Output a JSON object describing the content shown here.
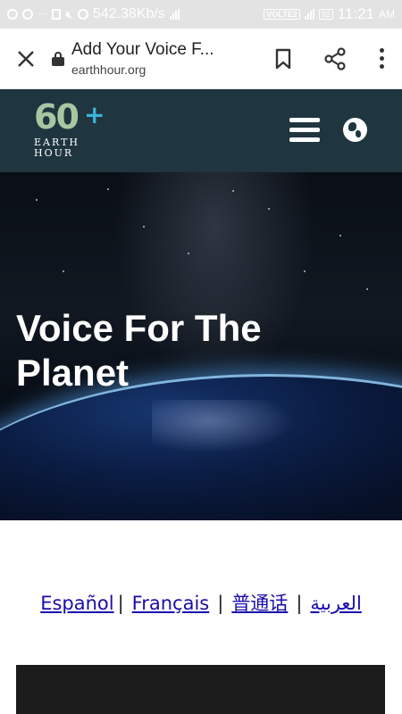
{
  "status_bar": {
    "network_speed": "542.38Kb/s",
    "volte": "VOLTE2",
    "battery": "92",
    "time": "11:21",
    "ampm": "AM"
  },
  "browser": {
    "close_icon": "close-icon",
    "page_title": "Add Your Voice F...",
    "url": "earthhour.org",
    "bookmark_icon": "bookmark-icon",
    "share_icon": "share-icon",
    "menu_icon": "more-vert-icon"
  },
  "site": {
    "logo_number": "60",
    "logo_plus": "+",
    "logo_line1": "EARTH",
    "logo_line2": "HOUR",
    "menu_icon": "hamburger-menu-icon",
    "language_icon": "globe-icon"
  },
  "hero": {
    "title_line1": "Voice For The",
    "title_line2": "Planet"
  },
  "languages": [
    {
      "label": "Español"
    },
    {
      "label": "Français"
    },
    {
      "label": "普通话"
    },
    {
      "label": "العربية"
    }
  ],
  "separator": "|",
  "colors": {
    "header_bg": "#1f3540",
    "link": "#1a0dab",
    "logo_green": "#a9c6a2",
    "logo_blue": "#3ab4d8"
  }
}
